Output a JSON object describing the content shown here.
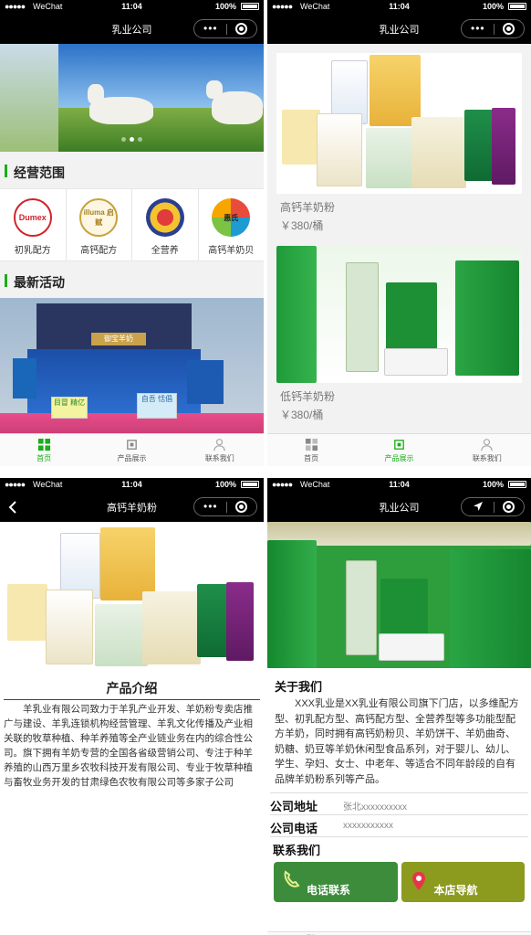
{
  "status": {
    "dots": "●●●●●",
    "carrier": "WeChat",
    "wifi": "ᯤ",
    "time": "11:04",
    "battery": "100%"
  },
  "capsule": {
    "more": "•••"
  },
  "panel1": {
    "title": "乳业公司",
    "scope_title": "经营范围",
    "categories": [
      {
        "logo": "Dumex",
        "name": "初乳配方",
        "color": "#d2232a"
      },
      {
        "logo": "illuma 启赋",
        "name": "高钙配方",
        "color": "#c8a33b"
      },
      {
        "logo": "",
        "name": "全营养",
        "color": "#2a3f8f"
      },
      {
        "logo": "惠氏",
        "name": "高钙羊奶贝",
        "color": "#1f9bd4"
      }
    ],
    "activity_title": "最新活动",
    "activity_sign": "御宝羊奶",
    "activity_cards": [
      "目冒  精亿",
      "自吾  恬倡"
    ]
  },
  "panel2": {
    "title": "乳业公司",
    "products": [
      {
        "name": "高钙羊奶粉",
        "price": "￥380/桶"
      },
      {
        "name": "低钙羊奶粉",
        "price": "￥380/桶"
      }
    ]
  },
  "panel3": {
    "title": "高钙羊奶粉",
    "intro_title": "产品介绍",
    "intro_body": "羊乳业有限公司致力于羊乳产业开发、羊奶粉专卖店推广与建设、羊乳连锁机构经营管理、羊乳文化传播及产业相关联的牧草种植、种羊养殖等全产业链业务在内的综合性公司。旗下拥有羊奶专营的全国各省级营销公司、专注于种羊养殖的山西万里乡农牧科技开发有限公司、专业于牧草种植与畜牧业务开发的甘肃绿色农牧有限公司等多家子公司"
  },
  "panel4": {
    "title": "乳业公司",
    "about_title": "关于我们",
    "about_body": "XXX乳业是XX乳业有限公司旗下门店，以多维配方型、初乳配方型、高钙配方型、全营养型等多功能型配方羊奶，同时拥有高钙奶粉贝、羊奶饼干、羊奶曲奇、奶糖、奶豆等羊奶休闲型食品系列，对于婴儿、幼儿、学生、孕妇、女士、中老年、等适合不同年龄段的自有品牌羊奶粉系列等产品。",
    "address_label": "公司地址",
    "address_value": "张北xxxxxxxxxx",
    "phone_label": "公司电话",
    "phone_value": "xxxxxxxxxxx",
    "contact_title": "联系我们",
    "btn_call": "电话联系",
    "btn_nav": "本店导航"
  },
  "tabbar": {
    "home": "首页",
    "products": "产品展示",
    "contact": "联系我们"
  },
  "colors": {
    "accent": "#1aad19",
    "nav": "#000000",
    "call_btn": "#3c8c3c",
    "nav_btn": "#8c9a1e"
  }
}
